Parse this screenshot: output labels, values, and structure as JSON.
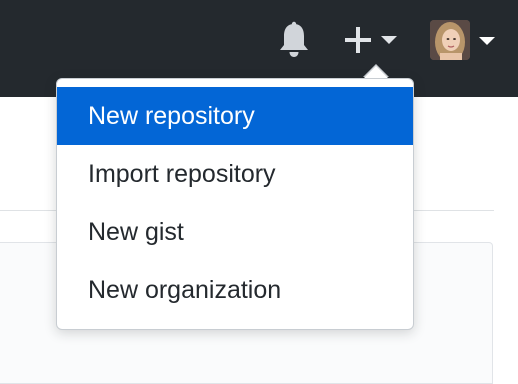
{
  "header": {
    "background": "#24292e",
    "icons": {
      "notifications": "bell-icon",
      "create": "plus-icon",
      "dropdown": "caret-down-icon"
    }
  },
  "create_menu": {
    "accent": "#0366d6",
    "items": [
      {
        "label": "New repository",
        "active": true
      },
      {
        "label": "Import repository",
        "active": false
      },
      {
        "label": "New gist",
        "active": false
      },
      {
        "label": "New organization",
        "active": false
      }
    ]
  }
}
